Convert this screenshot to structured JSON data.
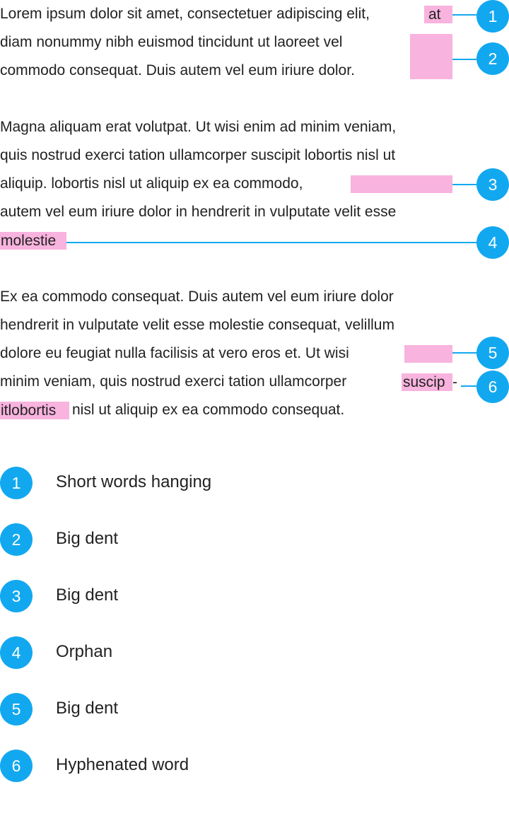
{
  "paragraphs": [
    {
      "lines": [
        "Lorem ipsum dolor sit amet, consectetuer adipiscing elit,",
        "diam nonummy nibh euismod tincidunt ut laoreet vel",
        "commodo consequat. Duis autem vel eum iriure dolor."
      ]
    },
    {
      "lines": [
        "Magna aliquam erat volutpat. Ut wisi enim ad minim veniam,",
        "quis nostrud exerci tation ullamcorper suscipit lobortis nisl ut",
        "aliquip. lobortis nisl ut aliquip ex ea commodo,",
        "autem vel eum iriure dolor in hendrerit in vulputate velit esse"
      ]
    },
    {
      "lines": [
        "Ex ea commodo consequat. Duis autem vel eum iriure dolor",
        "hendrerit in vulputate velit esse molestie consequat, velillum",
        "dolore eu feugiat nulla facilisis at vero eros et. Ut wisi",
        "minim veniam, quis nostrud exerci tation ullamcorper",
        "nisl ut aliquip ex ea commodo consequat."
      ]
    }
  ],
  "highlights": {
    "h1": "at",
    "h4": "molestie",
    "h6a": "suscip",
    "h6_hyphen": "-",
    "h6b": "itlobortis"
  },
  "markers": [
    "1",
    "2",
    "3",
    "4",
    "5",
    "6"
  ],
  "legend": [
    {
      "number": "1",
      "label": "Short words hanging"
    },
    {
      "number": "2",
      "label": "Big dent"
    },
    {
      "number": "3",
      "label": "Big dent"
    },
    {
      "number": "4",
      "label": "Orphan"
    },
    {
      "number": "5",
      "label": "Big dent"
    },
    {
      "number": "6",
      "label": "Hyphenated word"
    }
  ],
  "colors": {
    "highlight": "#f8b3de",
    "accent": "#12a8f0",
    "text": "#222222"
  }
}
